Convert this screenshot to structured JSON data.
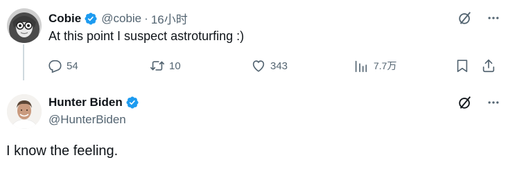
{
  "tweet1": {
    "author_name": "Cobie",
    "handle": "@cobie",
    "separator": "·",
    "time": "16小时",
    "text": "At this point I suspect astroturfing :)",
    "replies": "54",
    "reposts": "10",
    "likes": "343",
    "views": "7.7万"
  },
  "tweet2": {
    "author_name": "Hunter Biden",
    "handle": "@HunterBiden",
    "text": "I know the feeling."
  },
  "colors": {
    "verified": "#1d9bf0",
    "muted": "#536471",
    "text": "#0f1419",
    "thread_line": "#cfd9de"
  },
  "icons": [
    "reply-icon",
    "repost-icon",
    "like-icon",
    "views-icon",
    "bookmark-icon",
    "share-icon",
    "grok-icon",
    "more-icon",
    "verified-badge-icon"
  ]
}
